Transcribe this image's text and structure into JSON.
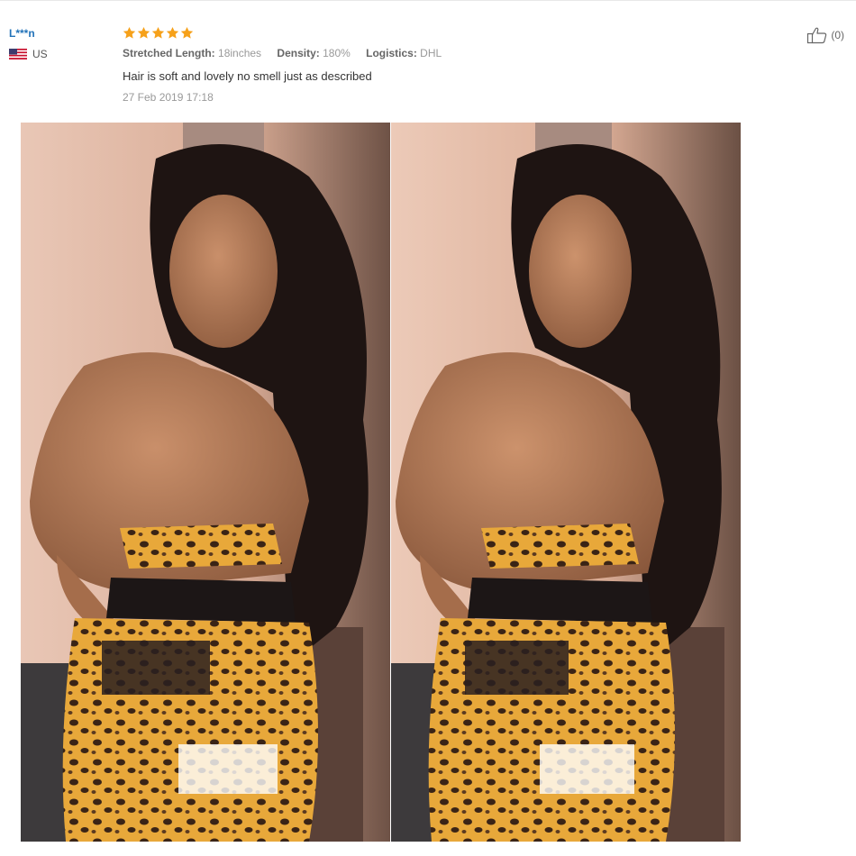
{
  "reviewer": {
    "name": "L***n",
    "country": "US",
    "flag_icon": "us-flag-icon"
  },
  "review": {
    "rating": 5,
    "star_color": "#f6a11a",
    "attributes": [
      {
        "key": "Stretched Length:",
        "value": "18inches"
      },
      {
        "key": "Density:",
        "value": "180%"
      },
      {
        "key": "Logistics:",
        "value": "DHL"
      }
    ],
    "text": "Hair is soft and lovely no smell just as described",
    "date": "27 Feb 2019 17:18"
  },
  "helpful": {
    "icon": "thumbs-up-icon",
    "count": "(0)"
  },
  "photos": [
    {
      "name": "review-photo-1"
    },
    {
      "name": "review-photo-2"
    }
  ],
  "colors": {
    "name_link": "#2273b9",
    "muted": "#999999",
    "text": "#333333"
  }
}
